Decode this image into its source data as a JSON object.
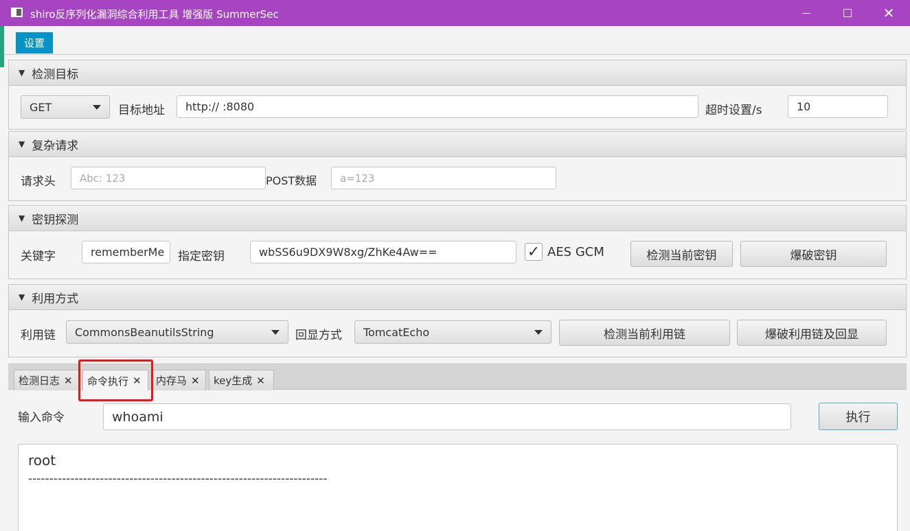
{
  "window": {
    "title": "shiro反序列化漏洞综合利用工具 增强版 SummerSec"
  },
  "menu": {
    "settings": "设置"
  },
  "target": {
    "header": "检测目标",
    "method": "GET",
    "url_label": "目标地址",
    "url_value": "http://               :8080",
    "timeout_label": "超时设置/s",
    "timeout_value": "10"
  },
  "complex": {
    "header": "复杂请求",
    "headers_label": "请求头",
    "headers_placeholder": "Abc: 123",
    "post_label": "POST数据",
    "post_placeholder": "a=123"
  },
  "key_detect": {
    "header": "密钥探测",
    "keyword_label": "关键字",
    "keyword_value": "rememberMe",
    "key_label": "指定密钥",
    "key_value": "wbSS6u9DX9W8xg/ZhKe4Aw==",
    "aes_gcm_label": "AES GCM",
    "aes_gcm_checked": true,
    "detect_key_button": "检测当前密钥",
    "brute_key_button": "爆破密钥"
  },
  "exploit": {
    "header": "利用方式",
    "chain_label": "利用链",
    "chain_value": "CommonsBeanutilsString",
    "echo_label": "回显方式",
    "echo_value": "TomcatEcho",
    "detect_chain_button": "检测当前利用链",
    "brute_chain_button": "爆破利用链及回显"
  },
  "tabs": [
    {
      "label": "检测日志",
      "active": false
    },
    {
      "label": "命令执行",
      "active": true
    },
    {
      "label": "内存马",
      "active": false
    },
    {
      "label": "key生成",
      "active": false
    }
  ],
  "command": {
    "input_label": "输入命令",
    "input_value": "whoami",
    "execute_button": "执行",
    "output_lines": [
      "root",
      "-----------------------------------------------------------------------"
    ]
  },
  "colors": {
    "titlebar": "#a644c2",
    "menu_accent": "#0693c9",
    "highlight": "#e21a1a"
  }
}
